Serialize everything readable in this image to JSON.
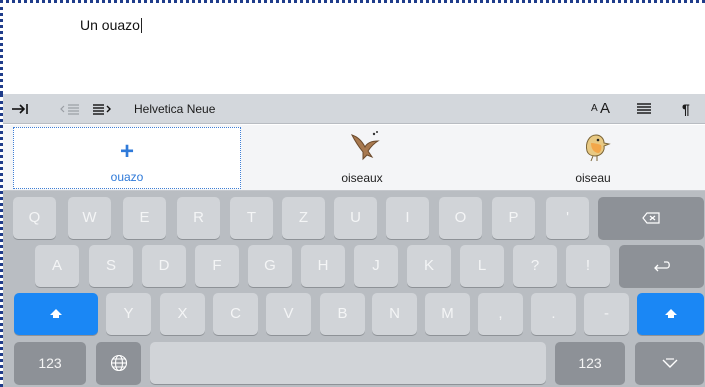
{
  "editor": {
    "text": "Un ouazo"
  },
  "format_bar": {
    "font_name": "Helvetica Neue",
    "text_size_small": "A",
    "text_size_large": "A",
    "paragraph_mark": "¶"
  },
  "suggestions": [
    {
      "label": "ouazo",
      "icon": "plus-icon"
    },
    {
      "label": "oiseaux",
      "icon": "flying-bird-icon"
    },
    {
      "label": "oiseau",
      "icon": "robin-bird-icon"
    }
  ],
  "keyboard": {
    "row1": [
      "Q",
      "W",
      "E",
      "R",
      "T",
      "Z",
      "U",
      "I",
      "O",
      "P",
      "'"
    ],
    "row2": [
      "A",
      "S",
      "D",
      "F",
      "G",
      "H",
      "J",
      "K",
      "L",
      "?",
      "!"
    ],
    "row3": [
      "Y",
      "X",
      "C",
      "V",
      "B",
      "N",
      "M",
      ",",
      ".",
      "-"
    ],
    "numbers_left": "123",
    "numbers_right": "123"
  },
  "colors": {
    "accent": "#1a87f5",
    "key_light": "#d1d4d8",
    "key_dark": "#8d9197",
    "keyboard_bg": "#b9bdc2"
  }
}
